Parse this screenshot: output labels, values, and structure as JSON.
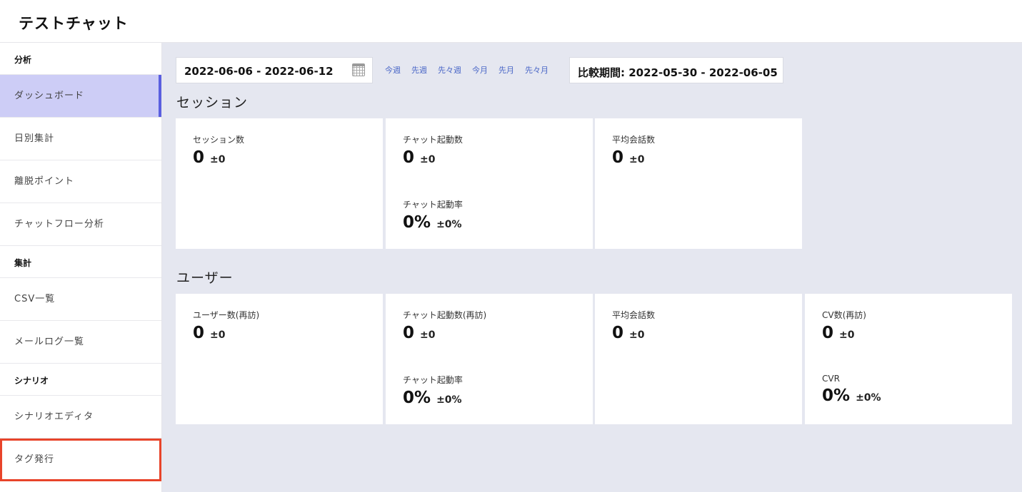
{
  "app": {
    "title": "テストチャット"
  },
  "sidebar": {
    "sections": [
      {
        "label": "分析",
        "items": [
          {
            "label": "ダッシュボード"
          },
          {
            "label": "日別集計"
          },
          {
            "label": "離脱ポイント"
          },
          {
            "label": "チャットフロー分析"
          }
        ]
      },
      {
        "label": "集計",
        "items": [
          {
            "label": "CSV一覧"
          },
          {
            "label": "メールログ一覧"
          }
        ]
      },
      {
        "label": "シナリオ",
        "items": [
          {
            "label": "シナリオエディタ"
          },
          {
            "label": "タグ発行"
          }
        ]
      }
    ]
  },
  "filters": {
    "date_range": "2022-06-06 - 2022-06-12",
    "quick_links": [
      "今週",
      "先週",
      "先々週",
      "今月",
      "先月",
      "先々月"
    ],
    "compare_period": "比較期間: 2022-05-30 - 2022-06-05"
  },
  "session": {
    "heading": "セッション",
    "cards": [
      {
        "metrics": [
          {
            "label": "セッション数",
            "value": "0",
            "diff": "±0"
          }
        ]
      },
      {
        "metrics": [
          {
            "label": "チャット起動数",
            "value": "0",
            "diff": "±0"
          },
          {
            "label": "チャット起動率",
            "value": "0%",
            "diff": "±0%"
          }
        ]
      },
      {
        "metrics": [
          {
            "label": "平均会話数",
            "value": "0",
            "diff": "±0"
          }
        ]
      }
    ]
  },
  "user": {
    "heading": "ユーザー",
    "cards": [
      {
        "metrics": [
          {
            "label": "ユーザー数(再訪)",
            "value": "0",
            "diff": "±0"
          }
        ]
      },
      {
        "metrics": [
          {
            "label": "チャット起動数(再訪)",
            "value": "0",
            "diff": "±0"
          },
          {
            "label": "チャット起動率",
            "value": "0%",
            "diff": "±0%"
          }
        ]
      },
      {
        "metrics": [
          {
            "label": "平均会話数",
            "value": "0",
            "diff": "±0"
          }
        ]
      },
      {
        "metrics": [
          {
            "label": "CV数(再訪)",
            "value": "0",
            "diff": "±0"
          },
          {
            "label": "CVR",
            "value": "0%",
            "diff": "±0%"
          }
        ]
      }
    ]
  },
  "colors": {
    "accent": "#5a5fe0",
    "active_bg": "#cdcdf6",
    "highlight_outline": "#e8442a",
    "main_bg": "#e5e7f0",
    "link": "#4a67c7"
  }
}
